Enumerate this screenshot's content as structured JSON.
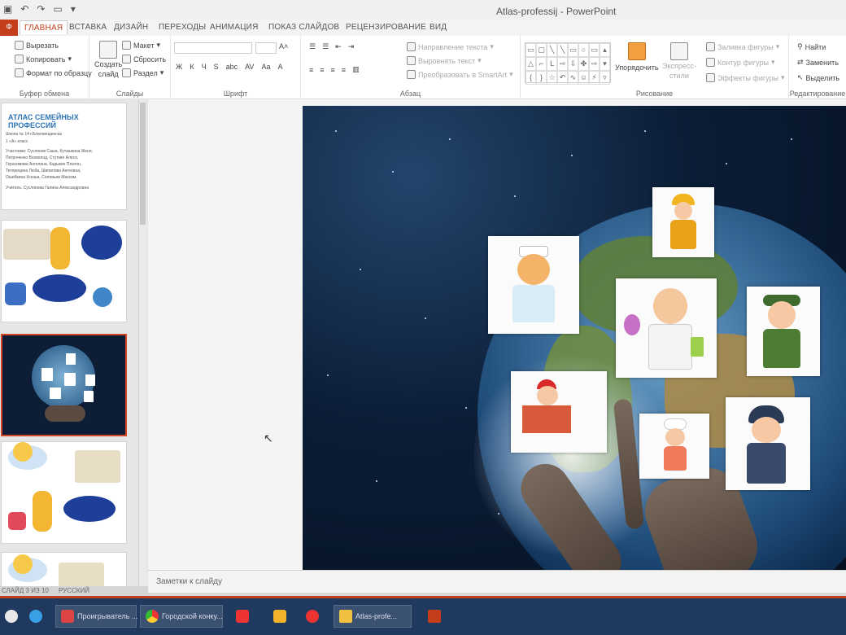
{
  "titlebar": {
    "doc_title": "Atlas-professij - PowerPoint"
  },
  "tabs": {
    "file": "Ф",
    "items": [
      "ГЛАВНАЯ",
      "ВСТАВКА",
      "ДИЗАЙН",
      "ПЕРЕХОДЫ",
      "АНИМАЦИЯ",
      "ПОКАЗ СЛАЙДОВ",
      "РЕЦЕНЗИРОВАНИЕ",
      "ВИД"
    ],
    "active": "ГЛАВНАЯ"
  },
  "ribbon": {
    "clipboard": {
      "cut": "Вырезать",
      "copy": "Копировать",
      "format_painter": "Формат по образцу",
      "label": "Буфер обмена"
    },
    "slides": {
      "new_slide": "Создать",
      "new_slide_2": "слайд",
      "layout": "Макет",
      "reset": "Сбросить",
      "section": "Раздел",
      "label": "Слайды"
    },
    "font": {
      "label": "Шрифт",
      "buttons": [
        "Ж",
        "К",
        "Ч",
        "S",
        "abc",
        "AV",
        "Aa",
        "A"
      ]
    },
    "paragraph": {
      "text_direction": "Направление текста",
      "align_text": "Выровнять текст",
      "smartart": "Преобразовать в SmartArt",
      "label": "Абзац"
    },
    "drawing": {
      "arrange": "Упорядочить",
      "quick_styles": "Экспресс-",
      "quick_styles_2": "стили",
      "fill": "Заливка фигуры",
      "outline": "Контур фигуры",
      "effects": "Эффекты фигуры",
      "label": "Рисование"
    },
    "editing": {
      "find": "Найти",
      "replace": "Заменить",
      "select": "Выделить",
      "label": "Редактирование"
    }
  },
  "thumb1": {
    "title": "АТЛАС СЕМЕЙНЫХ ПРОФЕССИЙ",
    "lines": [
      "Школа № 14 г.Благовещенска",
      "1 «А» класс",
      "Участники: Суслянов Саша, Куташкина Женя,",
      "Петроченко Всеволод, Стуткин Алеся,",
      "Герасимова Ангелина, Кадыкин Платон,",
      "Тетерицина Люба, Шипилова Ангелина,",
      "Ошибкина Ксюша, Соловьев Максим.",
      "Учитель: Суслянова Галина Александровна"
    ]
  },
  "notes": {
    "placeholder": "Заметки к слайду"
  },
  "statusbar": {
    "slide": "СЛАЙД 3 ИЗ 10",
    "lang": "РУССКИЙ"
  },
  "taskbar": {
    "items": [
      "Проигрыватель ...",
      "Городской конку...",
      "Atlas-profe..."
    ]
  },
  "colors": {
    "accent": "#c43e1c",
    "selection": "#d24726",
    "title_blue": "#2e75b6"
  }
}
